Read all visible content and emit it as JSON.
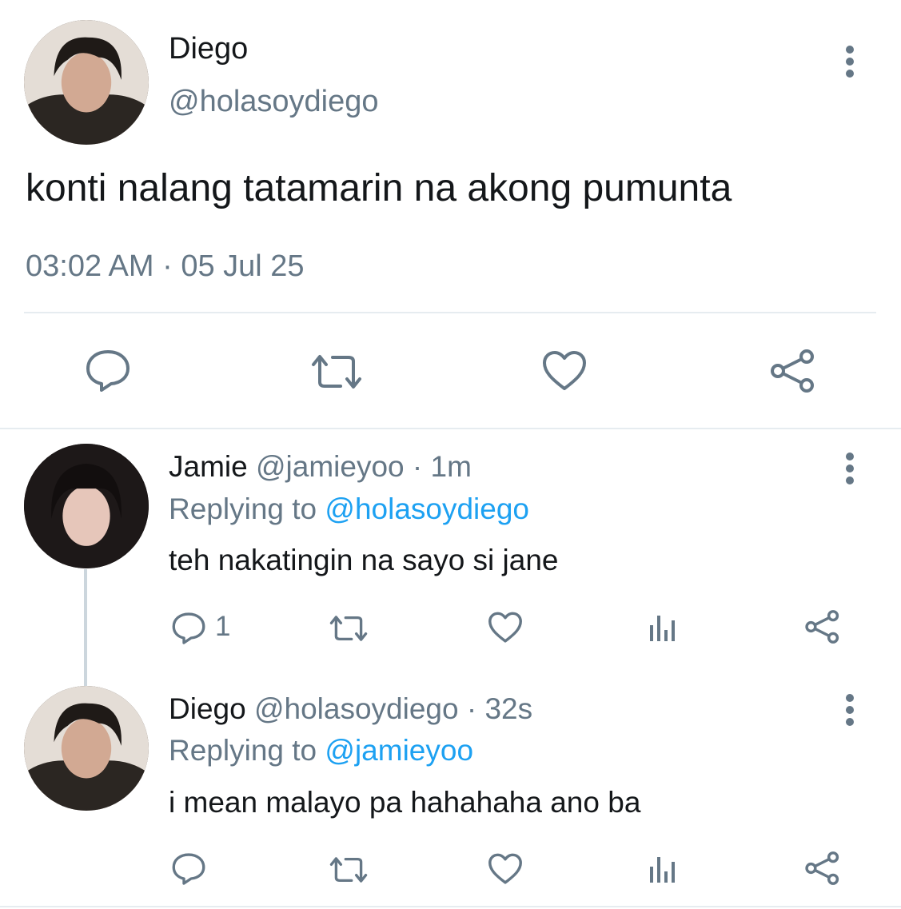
{
  "main_tweet": {
    "display_name": "Diego",
    "handle": "@holasoydiego",
    "text": "konti nalang tatamarin na akong pumunta",
    "timestamp": "03:02 AM · 05 Jul 25",
    "actions": [
      "reply-icon",
      "retweet-icon",
      "like-icon",
      "share-icon"
    ]
  },
  "replies": [
    {
      "display_name": "Jamie",
      "handle": "@jamieyoo",
      "time": "· 1m",
      "replying_label": "Replying to",
      "replying_to": "@holasoydiego",
      "text": "teh nakatingin na sayo si jane",
      "reply_count": "1"
    },
    {
      "display_name": "Diego",
      "handle": "@holasoydiego",
      "time": "· 32s",
      "replying_label": "Replying to",
      "replying_to": "@jamieyoo",
      "text": "i mean malayo pa hahahaha ano ba",
      "reply_count": ""
    }
  ],
  "colors": {
    "text": "#14171a",
    "secondary": "#657786",
    "link": "#1da1f2",
    "border": "#e6ecf0"
  }
}
